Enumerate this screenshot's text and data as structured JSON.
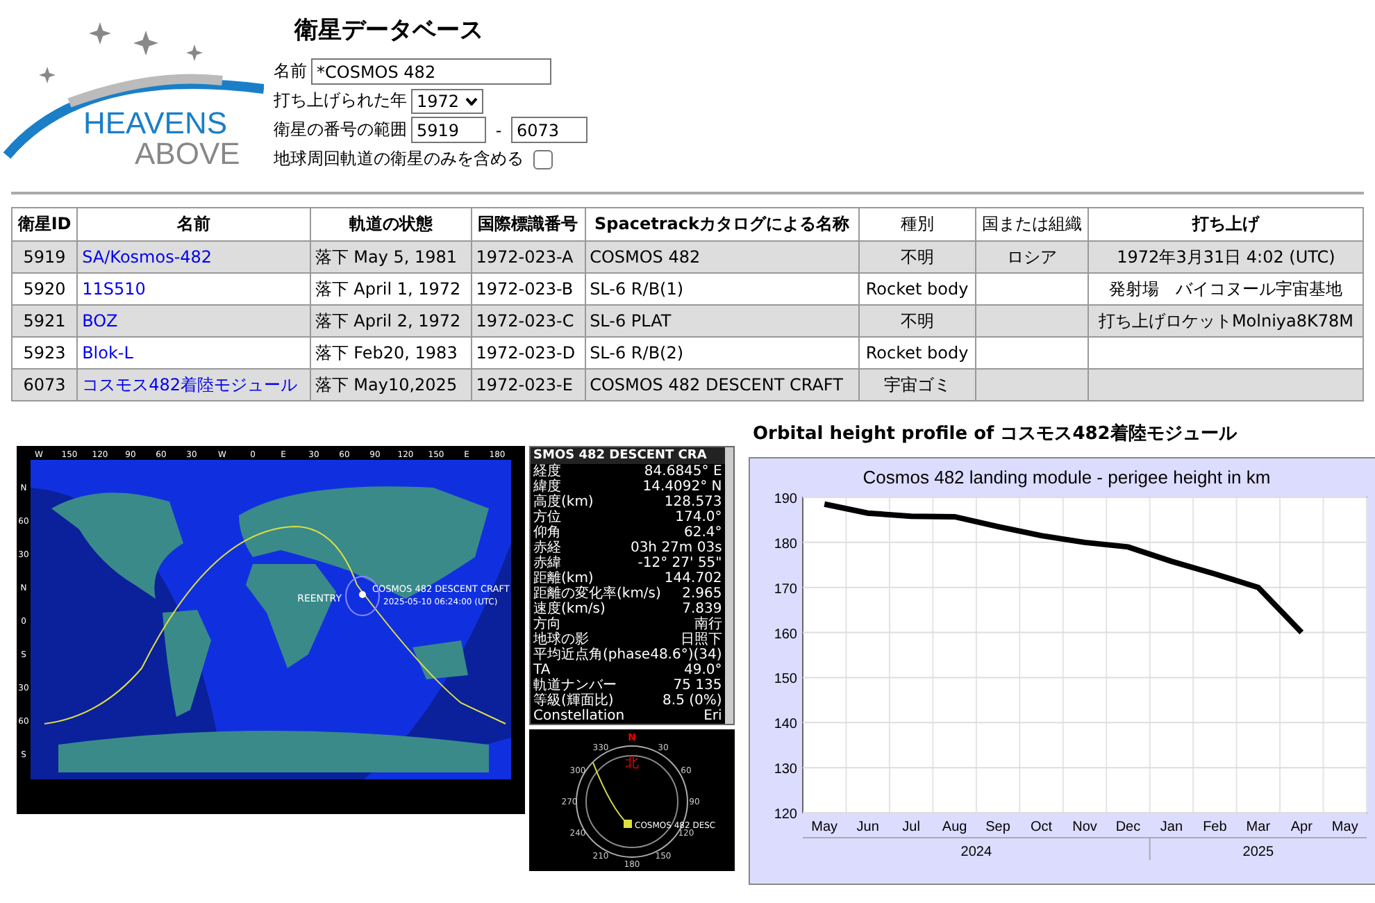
{
  "logo": {
    "line1": "HEAVENS",
    "line2": "ABOVE"
  },
  "title": "衛星データベース",
  "form": {
    "name": {
      "label": "名前",
      "value": "*COSMOS 482"
    },
    "year": {
      "label": "打ち上げられた年",
      "value": "1972"
    },
    "range": {
      "label": "衛星の番号の範囲",
      "from": "5919",
      "separator": "-",
      "to": "6073"
    },
    "orbit_only": {
      "label": "地球周回軌道の衛星のみを含める",
      "checked": false
    }
  },
  "table": {
    "columns": [
      "衛星ID",
      "名前",
      "軌道の状態",
      "国際標識番号",
      "Spacetrackカタログによる名称",
      "種別",
      "国または組織",
      "打ち上げ"
    ],
    "rows": [
      {
        "id": "5919",
        "name": "SA/Kosmos-482",
        "status": "落下 May 5, 1981",
        "intl_id": "1972-023-A",
        "spacetrack_name": "COSMOS 482",
        "kind": "不明",
        "country": "ロシア",
        "launch": "1972年3月31日 4:02 (UTC)"
      },
      {
        "id": "5920",
        "name": "11S510",
        "status": "落下 April 1, 1972",
        "intl_id": "1972-023-B",
        "spacetrack_name": "SL-6 R/B(1)",
        "kind": "Rocket body",
        "country": "",
        "launch": "発射場　バイコヌール宇宙基地"
      },
      {
        "id": "5921",
        "name": "BOZ",
        "status": "落下 April 2, 1972",
        "intl_id": "1972-023-C",
        "spacetrack_name": "SL-6 PLAT",
        "kind": "不明",
        "country": "",
        "launch": "打ち上げロケットMolniya8K78M"
      },
      {
        "id": "5923",
        "name": "Blok-L",
        "status": "落下 Feb20, 1983",
        "intl_id": "1972-023-D",
        "spacetrack_name": "SL-6 R/B(2)",
        "kind": "Rocket body",
        "country": "",
        "launch": ""
      },
      {
        "id": "6073",
        "name": "コスモス482着陸モジュール",
        "status": "落下 May10,2025",
        "intl_id": "1972-023-E",
        "spacetrack_name": "COSMOS 482 DESCENT CRAFT",
        "kind": "宇宙ゴミ",
        "country": "",
        "launch": ""
      }
    ]
  },
  "map": {
    "top_ticks": [
      "W",
      "150",
      "120",
      "90",
      "60",
      "30",
      "W",
      "0",
      "E",
      "30",
      "60",
      "90",
      "120",
      "150",
      "E",
      "180"
    ],
    "left_ticks": [
      "N",
      "60",
      "30",
      "N",
      "0",
      "S",
      "30",
      "60",
      "S"
    ],
    "reentry_label": "REENTRY",
    "craft_label": "COSMOS 482 DESCENT CRAFT",
    "time_label": "2025-05-10 06:24:00 (UTC)"
  },
  "info_panel": {
    "header": "SMOS 482 DESCENT CRA",
    "rows": [
      {
        "label": "経度",
        "value": "84.6845° E"
      },
      {
        "label": "緯度",
        "value": "14.4092° N"
      },
      {
        "label": "高度(km)",
        "value": "128.573"
      },
      {
        "label": "方位",
        "value": "174.0°"
      },
      {
        "label": "仰角",
        "value": "62.4°"
      },
      {
        "label": "赤経",
        "value": "03h 27m 03s"
      },
      {
        "label": "赤緯",
        "value": "-12° 27' 55\""
      },
      {
        "label": "距離(km)",
        "value": "144.702"
      },
      {
        "label": "距離の変化率(km/s)",
        "value": "2.965"
      },
      {
        "label": "速度(km/s)",
        "value": "7.839"
      },
      {
        "label": "方向",
        "value": "南行"
      },
      {
        "label": "地球の影",
        "value": "日照下"
      },
      {
        "label": "平均近点角(phase48.6°)",
        "value": "(34)"
      },
      {
        "label": "TA",
        "value": "49.0°"
      },
      {
        "label": "軌道ナンバー",
        "value": "75 135"
      },
      {
        "label": "等級(輝面比)",
        "value": "8.5 (0%)"
      },
      {
        "label": "Constellation",
        "value": "Eri"
      }
    ]
  },
  "compass": {
    "north": "N",
    "north_kanji": "北",
    "bearings": [
      "30",
      "60",
      "90",
      "120",
      "150",
      "180",
      "210",
      "240",
      "270",
      "300",
      "330"
    ],
    "craft_label": "COSMOS 482 DESC"
  },
  "height_profile": {
    "heading": "Orbital height profile of コスモス482着陸モジュール",
    "years": [
      "2024",
      "2025"
    ],
    "chart_data": {
      "type": "line",
      "title": "Cosmos 482 landing module - perigee height in km",
      "categories": [
        "May",
        "Jun",
        "Jul",
        "Aug",
        "Sep",
        "Oct",
        "Nov",
        "Dec",
        "Jan",
        "Feb",
        "Mar",
        "Apr",
        "May"
      ],
      "ylim": [
        120,
        190
      ],
      "grid": true,
      "yticks": [
        120,
        130,
        140,
        150,
        160,
        170,
        180,
        190
      ],
      "series": [
        {
          "color": "#000000",
          "values": [
            188.5,
            186.5,
            185.8,
            185.7,
            183.5,
            181.5,
            180,
            179,
            175.8,
            173,
            170,
            160,
            null
          ]
        }
      ]
    }
  }
}
